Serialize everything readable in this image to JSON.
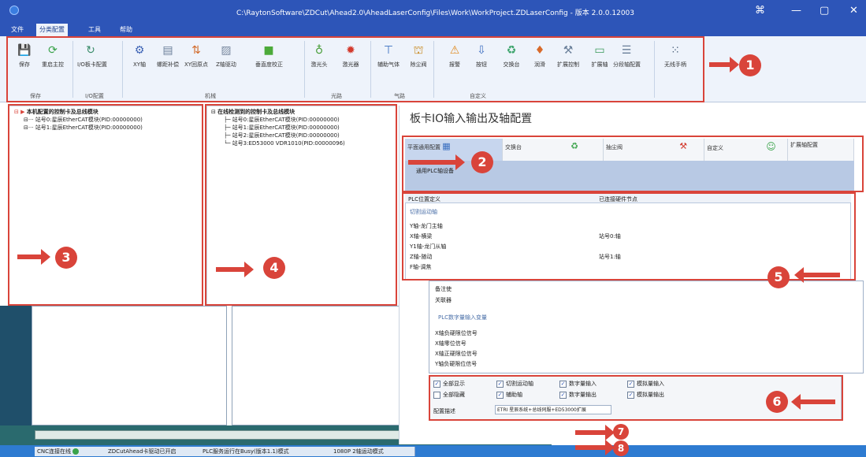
{
  "window": {
    "title": "C:\\RaytonSoftware\\ZDCut\\Ahead2.0\\AheadLaserConfig\\Files\\Work\\WorkProject.ZDLaserConfig - 版本 2.0.0.12003"
  },
  "menu": {
    "tabs": [
      "文件",
      "分类配置",
      "工具",
      "帮助"
    ],
    "active": "分类配置"
  },
  "ribbon": {
    "buttons": [
      {
        "label": "保存",
        "icon": "floppy-icon",
        "color": "#2b4f9e"
      },
      {
        "label": "重启主控",
        "icon": "refresh-icon",
        "color": "#3aa34a"
      },
      {
        "label": "I/O板卡配置",
        "icon": "gear-refresh-icon",
        "color": "#3a8c6a"
      },
      {
        "label": "XY轴",
        "icon": "gear-icon",
        "color": "#3d63b5"
      },
      {
        "label": "螺距补偿",
        "icon": "table-icon",
        "color": "#6a7f99"
      },
      {
        "label": "XY回原点",
        "icon": "arrows-icon",
        "color": "#d26a2a"
      },
      {
        "label": "Z轴驱动",
        "icon": "chart-icon",
        "color": "#7a8aa0"
      },
      {
        "label": "垂直度校正",
        "icon": "square-icon",
        "color": "#4caa3a"
      },
      {
        "label": "激光头",
        "icon": "bulb-icon",
        "color": "#4a9f3b"
      },
      {
        "label": "激光器",
        "icon": "burst-icon",
        "color": "#d33a2d"
      },
      {
        "label": "辅助气体",
        "icon": "valve-icon",
        "color": "#3a6fc0"
      },
      {
        "label": "除尘阀",
        "icon": "fan-icon",
        "color": "#c8881e"
      },
      {
        "label": "报警",
        "icon": "warning-icon",
        "color": "#e08a1e"
      },
      {
        "label": "按钮",
        "icon": "download-icon",
        "color": "#3d6fc0"
      },
      {
        "label": "交换台",
        "icon": "recycle-icon",
        "color": "#3aa36a"
      },
      {
        "label": "润滑",
        "icon": "drop-icon",
        "color": "#d86a2a"
      },
      {
        "label": "扩展控制",
        "icon": "tools-icon",
        "color": "#6a7f99"
      },
      {
        "label": "扩展轴",
        "icon": "display-icon",
        "color": "#3a9a5a"
      },
      {
        "label": "分段轴配置",
        "icon": "list-icon",
        "color": "#6a7f99"
      },
      {
        "label": "无线手柄",
        "icon": "grid-icon",
        "color": "#4a5f7a"
      }
    ],
    "groups": [
      "保存",
      "I/O配置",
      "机械",
      "光路",
      "气路",
      "自定义"
    ]
  },
  "panes": {
    "left": {
      "title": "本机配置的控制卡及总线模块",
      "items": [
        "站号0:星辰EtherCAT模块(PID:00000000)",
        "站号1:星辰EtherCAT模块(PID:00000000)"
      ]
    },
    "middle": {
      "title": "在线检测到的控制卡及总线模块",
      "items": [
        "站号0:星辰EtherCAT模块(PID:00000000)",
        "站号1:星辰EtherCAT模块(PID:00000000)",
        "站号2:星辰EtherCAT模块(PID:00000000)",
        "站号3:ED53000 VDR1010(PID:00000096)"
      ]
    }
  },
  "content": {
    "title": "板卡IO输入输出及轴配置",
    "tabs": [
      "平面通用配置",
      "交换台",
      "抽尘阀",
      "自定义",
      "扩展轴配置"
    ],
    "tab_sub": "通用PLC轴设备",
    "table_headers": [
      "PLC位置定义",
      "已连接硬件节点"
    ],
    "section_axes": "切割运动轴",
    "axes": [
      {
        "name": "Y轴-龙门主轴",
        "node": ""
      },
      {
        "name": "X轴-横梁",
        "node": "站号0:轴"
      },
      {
        "name": "Y1轴-龙门从轴",
        "node": ""
      },
      {
        "name": "Z轴-随动",
        "node": "站号1:轴"
      },
      {
        "name": "F轴-调焦",
        "node": ""
      }
    ],
    "section_digital": "PLC数字量输入变量",
    "digital_inputs": [
      "X轴负硬限位信号",
      "X轴零位信号",
      "X轴正硬限位信号",
      "Y轴负硬限位信号"
    ],
    "popup_labels": [
      "备注使",
      "关联器"
    ],
    "filters": [
      {
        "label": "全部显示",
        "checked": true
      },
      {
        "label": "切割运动轴",
        "checked": true
      },
      {
        "label": "数字量输入",
        "checked": true
      },
      {
        "label": "模拟量输入",
        "checked": true
      },
      {
        "label": "全部隐藏",
        "checked": false
      },
      {
        "label": "辅助轴",
        "checked": true
      },
      {
        "label": "数字量输出",
        "checked": true
      },
      {
        "label": "模拟量输出",
        "checked": true
      }
    ],
    "config_desc_label": "配置描述",
    "config_desc_value": "ETRI 星辰系统+总线伺服+ED53000扩展"
  },
  "status": {
    "items": [
      "CNC连接在线",
      "ZDCutAhead卡驱动已开启",
      "PLC服务运行在Busy(版本1.1)模式",
      "1080P 2轴运动模式"
    ],
    "ok_color": "#3aa34a"
  },
  "annotations": [
    "1",
    "2",
    "3",
    "4",
    "5",
    "6",
    "7",
    "8"
  ],
  "colors": {
    "annotation": "#d9443a",
    "titlebar": "#2d55b8"
  }
}
